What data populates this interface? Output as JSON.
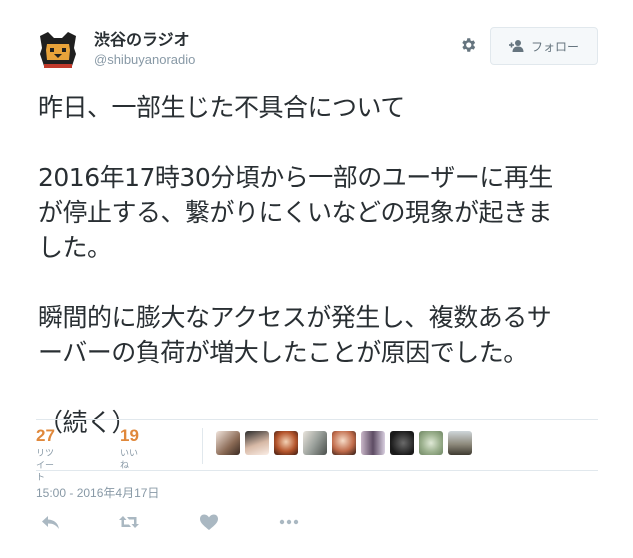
{
  "user": {
    "display_name": "渋谷のラジオ",
    "screen_name": "@shibuyanoradio"
  },
  "follow_button": {
    "label": "フォロー",
    "icon": "add-user-icon"
  },
  "settings_icon": "gear-icon",
  "tweet": {
    "lines": [
      "昨日、一部生じた不具合について",
      "",
      "2016年17時30分頃から一部のユーザーに再生",
      "が停止する、繋がりにくいなどの現象が起きま",
      "した。",
      "",
      "瞬間的に膨大なアクセスが発生し、複数あるサ",
      "ーバーの負荷が増大したことが原因でした。",
      "",
      "（続く）"
    ]
  },
  "stats": {
    "retweets": {
      "count": "27",
      "label": "リツイート"
    },
    "likes": {
      "count": "19",
      "label": "いいね"
    }
  },
  "likers": [
    "liker-avatar",
    "liker-avatar",
    "liker-avatar",
    "liker-avatar",
    "liker-avatar",
    "liker-avatar",
    "liker-avatar",
    "liker-avatar",
    "liker-avatar"
  ],
  "timestamp": "15:00 - 2016年4月17日",
  "actions": [
    "reply-icon",
    "retweet-icon",
    "like-heart-icon",
    "more-icon"
  ],
  "colors": {
    "accent": "#e0883b",
    "muted": "#8899a6",
    "icon": "#aab8c2",
    "border": "#e1e8ed"
  }
}
